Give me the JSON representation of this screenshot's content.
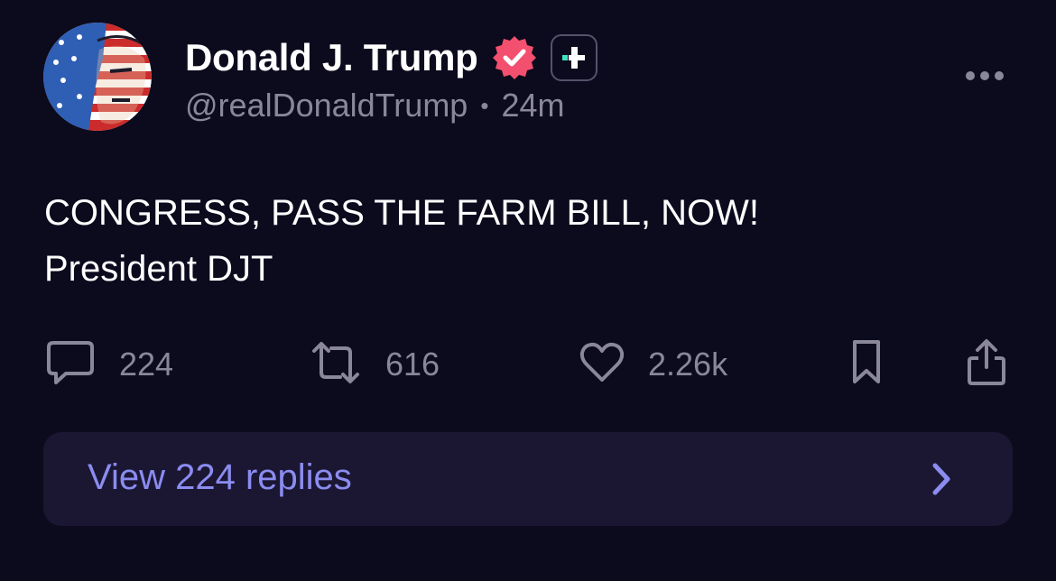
{
  "author": {
    "display_name": "Donald J. Trump",
    "handle": "@realDonaldTrump",
    "time_ago": "24m",
    "separator": "•",
    "verified": true
  },
  "post": {
    "lines": [
      "CONGRESS, PASS THE FARM BILL, NOW!",
      "President DJT"
    ]
  },
  "actions": {
    "replies_count": "224",
    "reposts_count": "616",
    "likes_count": "2.26k"
  },
  "replies_bar": {
    "label": "View 224 replies"
  },
  "icons": {
    "verified": "verified-badge-icon",
    "plus": "truth-plus-icon",
    "more": "more-horizontal-icon",
    "reply": "comment-icon",
    "repost": "repost-icon",
    "like": "heart-icon",
    "bookmark": "bookmark-icon",
    "share": "share-icon",
    "chevron": "chevron-right-icon"
  },
  "colors": {
    "background": "#0c0a1d",
    "verified": "#f2506e",
    "plus_accent": "#3fe0c0",
    "muted_text": "#8a8799",
    "link": "#8b8cf0",
    "replies_bar": "#1b1733"
  }
}
